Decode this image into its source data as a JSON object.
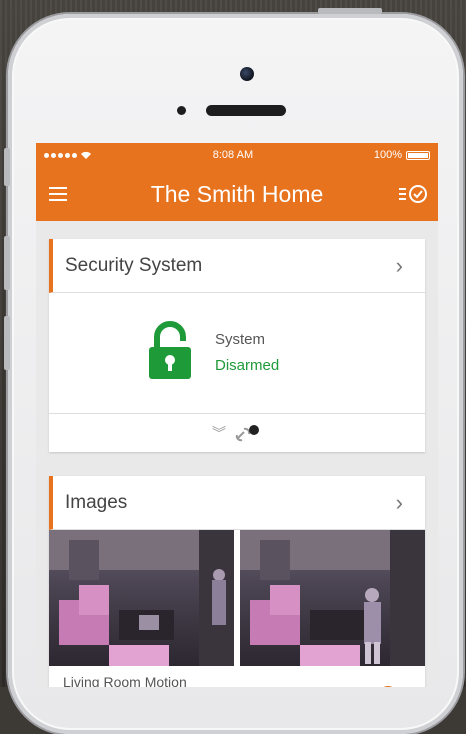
{
  "status_bar": {
    "time": "8:08 AM",
    "battery": "100%"
  },
  "nav": {
    "title": "The Smith Home",
    "menu_icon": "hamburger-menu-icon",
    "tasks_icon": "checklist-icon"
  },
  "security": {
    "title": "Security System",
    "system_label": "System",
    "state": "Disarmed",
    "state_color": "#1f9a39"
  },
  "images": {
    "title": "Images",
    "caption": "Living Room Motion"
  },
  "colors": {
    "accent": "#e8731f"
  }
}
